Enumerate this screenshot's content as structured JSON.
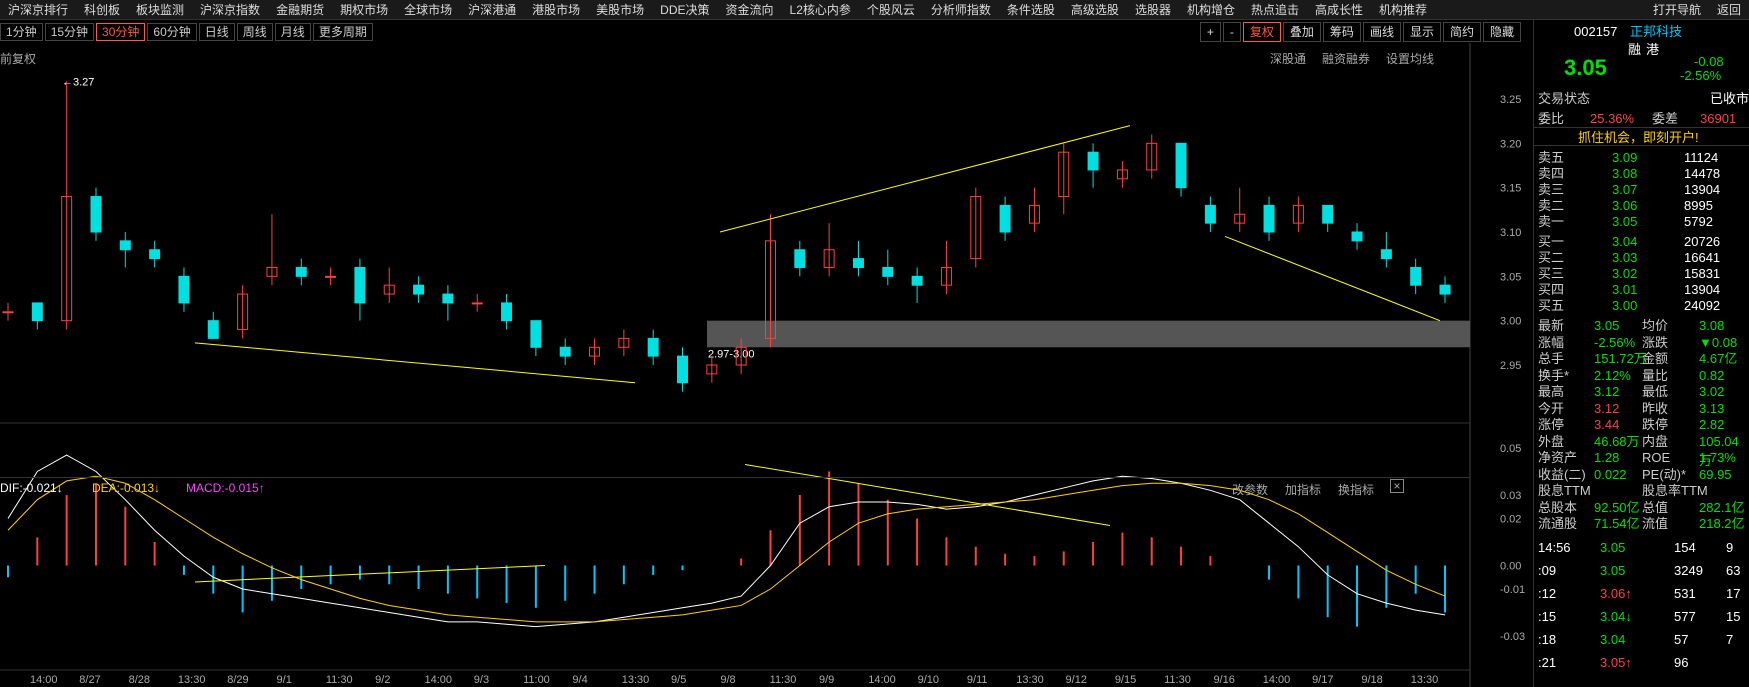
{
  "menu": [
    "沪深京排行",
    "科创板",
    "板块监测",
    "沪深京指数",
    "金融期货",
    "期权市场",
    "全球市场",
    "沪深港通",
    "港股市场",
    "美股市场",
    "DDE决策",
    "资金流向",
    "L2核心内参",
    "个股风云",
    "分析师指数",
    "条件选股",
    "高级选股",
    "选股器",
    "机构增仓",
    "热点追击",
    "高成长性",
    "机构推荐"
  ],
  "menu_right": [
    "打开导航",
    "返回"
  ],
  "periods": [
    "1分钟",
    "15分钟",
    "30分钟",
    "60分钟",
    "日线",
    "周线",
    "月线",
    "更多周期"
  ],
  "active_period": "30分钟",
  "toolbar": [
    "+",
    "-",
    "复权",
    "叠加",
    "筹码",
    "画线",
    "显示",
    "简约",
    "隐藏"
  ],
  "sub_links": [
    "深股通",
    "融资融券",
    "设置均线"
  ],
  "fq_label": "前复权",
  "chart_data": [
    {
      "type": "candlestick",
      "title": "",
      "y_ticks": [
        3.25,
        3.2,
        3.15,
        3.1,
        3.05,
        3.0,
        2.95
      ],
      "ylim": [
        2.915,
        3.305
      ],
      "annotations": [
        "3.27",
        "2.97-3.00"
      ],
      "x_labels": [
        "14:00",
        "8/27",
        "8/28",
        "13:30",
        "8/29",
        "9/1",
        "11:30",
        "9/2",
        "14:00",
        "9/3",
        "11:00",
        "9/4",
        "13:30",
        "9/5",
        "9/8",
        "11:30",
        "9/9",
        "14:00",
        "9/10",
        "9/11",
        "13:30",
        "9/12",
        "9/15",
        "11:30",
        "9/16",
        "14:00",
        "9/17",
        "9/18",
        "13:30"
      ]
    },
    {
      "type": "bar",
      "title": "MACD",
      "y_ticks": [
        0.05,
        0.03,
        0.02,
        0.0,
        -0.01,
        -0.03
      ],
      "ylim": [
        -0.04,
        0.06
      ],
      "legend": [
        {
          "name": "DIF",
          "value": "-0.021"
        },
        {
          "name": "DEA",
          "value": "-0.013"
        },
        {
          "name": "MACD",
          "value": "-0.015"
        }
      ],
      "links": [
        "改参数",
        "加指标",
        "换指标"
      ]
    }
  ],
  "panel": {
    "code": "002157",
    "name": "正邦科技",
    "tags": [
      "融",
      "港"
    ],
    "price": "3.05",
    "change": "-0.08",
    "pct": "-2.56%",
    "status_label": "交易状态",
    "status": "已收市",
    "weibi_label": "委比",
    "weibi": "25.36%",
    "weicha_label": "委差",
    "weicha": "36901",
    "promo": "抓住机会，即刻开户!",
    "sells": [
      [
        "卖五",
        "3.09",
        "11124"
      ],
      [
        "卖四",
        "3.08",
        "14478"
      ],
      [
        "卖三",
        "3.07",
        "13904"
      ],
      [
        "卖二",
        "3.06",
        "8995"
      ],
      [
        "卖一",
        "3.05",
        "5792"
      ]
    ],
    "buys": [
      [
        "买一",
        "3.04",
        "20726"
      ],
      [
        "买二",
        "3.03",
        "16641"
      ],
      [
        "买三",
        "3.02",
        "15831"
      ],
      [
        "买四",
        "3.01",
        "13904"
      ],
      [
        "买五",
        "3.00",
        "24092"
      ]
    ],
    "stats": [
      [
        "最新",
        "3.05",
        "均价",
        "3.08"
      ],
      [
        "涨幅",
        "-2.56%",
        "涨跌",
        "▼0.08"
      ],
      [
        "总手",
        "151.72万",
        "金额",
        "4.67亿"
      ],
      [
        "换手*",
        "2.12%",
        "量比",
        "0.82"
      ],
      [
        "最高",
        "3.12",
        "最低",
        "3.02"
      ],
      [
        "今开",
        "3.12",
        "昨收",
        "3.13"
      ],
      [
        "涨停",
        "3.44",
        "跌停",
        "2.82"
      ],
      [
        "外盘",
        "46.68万",
        "内盘",
        "105.04万"
      ],
      [
        "净资产",
        "1.28",
        "ROE",
        "1.73%"
      ],
      [
        "收益(二)",
        "0.022",
        "PE(动)*",
        "69.95"
      ],
      [
        "股息TTM",
        "",
        "股息率TTM",
        ""
      ],
      [
        "总股本",
        "92.50亿",
        "总值",
        "282.1亿"
      ],
      [
        "流通股",
        "71.54亿",
        "流值",
        "218.2亿"
      ]
    ],
    "ticks": [
      [
        "14:56",
        "3.05",
        "154",
        "9"
      ],
      [
        ":09",
        "3.05",
        "3249",
        "63"
      ],
      [
        ":12",
        "3.06↑",
        "531",
        "17"
      ],
      [
        ":15",
        "3.04↓",
        "577",
        "15"
      ],
      [
        ":18",
        "3.04",
        "57",
        "7"
      ],
      [
        ":21",
        "3.05↑",
        "96",
        ""
      ]
    ]
  }
}
